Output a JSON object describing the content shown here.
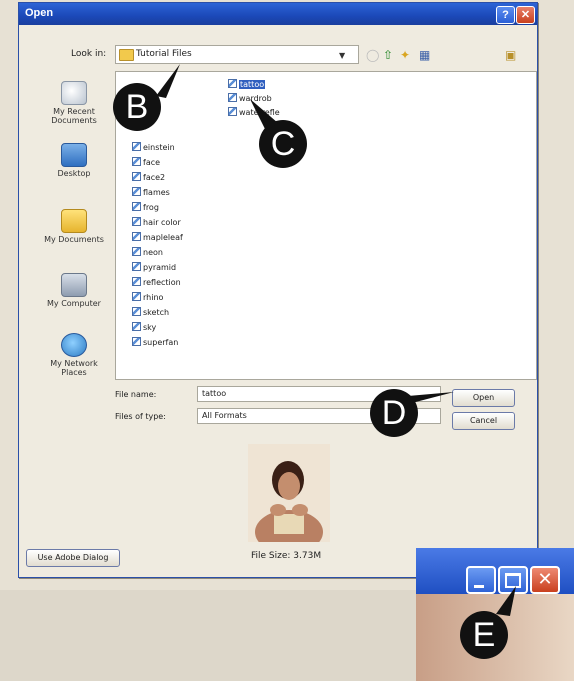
{
  "window": {
    "title": "Open",
    "help_label": "?",
    "close_label": "✕"
  },
  "look_in": {
    "label": "Look in:",
    "value": "Tutorial Files"
  },
  "places": [
    {
      "id": "recent",
      "label": "My Recent Documents",
      "icon": "recent-documents-icon"
    },
    {
      "id": "desktop",
      "label": "Desktop",
      "icon": "desktop-icon"
    },
    {
      "id": "documents",
      "label": "My Documents",
      "icon": "my-documents-icon"
    },
    {
      "id": "computer",
      "label": "My Computer",
      "icon": "my-computer-icon"
    },
    {
      "id": "network",
      "label": "My Network Places",
      "icon": "network-places-icon"
    }
  ],
  "files_col1": [
    "einstein",
    "face",
    "face2",
    "flames",
    "frog",
    "hair color",
    "mapleleaf",
    "neon",
    "pyramid",
    "reflection",
    "rhino",
    "sketch",
    "sky",
    "superfan"
  ],
  "files_col2": [
    "tattoo",
    "wardrob",
    "waterrefle"
  ],
  "selected_file": "tattoo",
  "file_name": {
    "label": "File name:",
    "value": "tattoo"
  },
  "file_type": {
    "label": "Files of type:",
    "value": "All Formats"
  },
  "buttons": {
    "open": "Open",
    "cancel": "Cancel",
    "adobe_dialog": "Use Adobe Dialog"
  },
  "preview": {
    "file_size": "File Size: 3.73M"
  },
  "callouts": [
    "B",
    "C",
    "D",
    "E"
  ],
  "colors": {
    "title_bar": "#1b48b8",
    "selection": "#2f5fbf",
    "close_button": "#c8401e"
  }
}
